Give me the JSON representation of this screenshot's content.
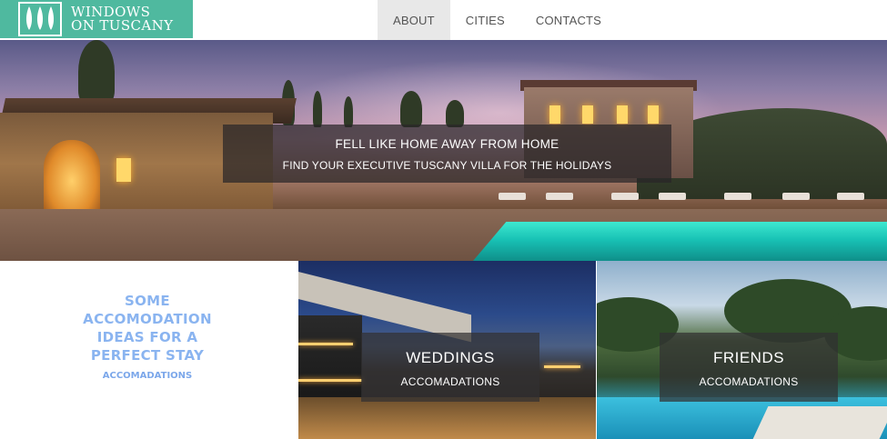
{
  "brand": {
    "logo_line1": "WINDOWS",
    "logo_line2": "ON TUSCANY",
    "logo_color": "#4fb99f"
  },
  "nav": {
    "items": [
      {
        "label": "ABOUT",
        "active": true
      },
      {
        "label": "CITIES",
        "active": false
      },
      {
        "label": "CONTACTS",
        "active": false
      }
    ]
  },
  "hero": {
    "title": "FELL LIKE HOME AWAY FROM HOME",
    "subtitle": "FIND YOUR EXECUTIVE TUSCANY VILLA FOR THE HOLIDAYS"
  },
  "intro": {
    "title": "SOME ACCOMODATION IDEAS FOR A PERFECT STAY",
    "link": "ACCOMADATIONS",
    "accent_color": "#8ab4f0"
  },
  "tiles": [
    {
      "title": "WEDDINGS",
      "link": "ACCOMADATIONS"
    },
    {
      "title": "FRIENDS",
      "link": "ACCOMADATIONS"
    }
  ]
}
